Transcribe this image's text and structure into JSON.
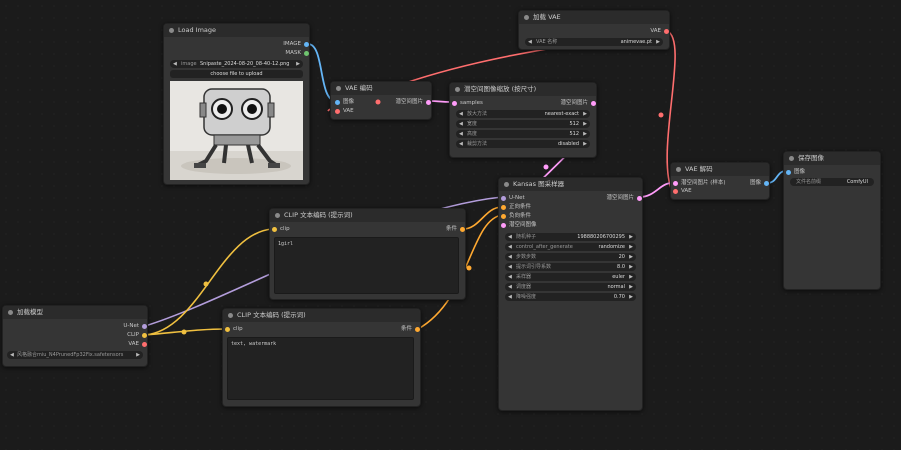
{
  "colors": {
    "clip": "#f0c040",
    "model": "#b39ddb",
    "vae": "#ff6e6e",
    "latent": "#ff9cf9",
    "image": "#64b5f6",
    "conditioning": "#ffa931"
  },
  "load_image": {
    "title": "Load Image",
    "out_image": "IMAGE",
    "out_mask": "MASK",
    "image_label": "image",
    "image_value": "Snipaste_2024-08-20_08-40-12.png",
    "upload_button": "choose file to upload"
  },
  "vae_loader": {
    "title": "加载 VAE",
    "out_vae": "VAE",
    "name_label": "VAE 名称",
    "name_value": "animevae.pt"
  },
  "vae_encode": {
    "title": "VAE 编码",
    "in_pixels": "图像",
    "in_vae": "VAE",
    "out_latent": "潜空间图片"
  },
  "latent_upscale": {
    "title": "潜空间图像缩放 (按尺寸)",
    "in_samples": "samples",
    "out_latent": "潜空间图片",
    "widgets": [
      {
        "label": "放大方法",
        "value": "nearest-exact"
      },
      {
        "label": "宽度",
        "value": "512"
      },
      {
        "label": "高度",
        "value": "512"
      },
      {
        "label": "裁剪方法",
        "value": "disabled"
      }
    ]
  },
  "vae_decode": {
    "title": "VAE 解码",
    "in_samples": "潜空间图片 (样本)",
    "in_vae": "VAE",
    "out_image": "图像"
  },
  "save_image": {
    "title": "保存图像",
    "in_images": "图像",
    "prefix_label": "文件名前缀",
    "prefix_value": "ComfyUI"
  },
  "ksampler": {
    "title": "Kansas 图采样器",
    "in_model": "U-Net",
    "in_positive": "正向条件",
    "in_negative": "负向条件",
    "in_latent": "潜空间图像",
    "out_latent": "潜空间图片",
    "widgets": [
      {
        "label": "随机种子",
        "value": "198880206700295"
      },
      {
        "label": "control_after_generate",
        "value": "randomize"
      },
      {
        "label": "步数步数",
        "value": "20"
      },
      {
        "label": "提示词引导系数",
        "value": "8.0"
      },
      {
        "label": "采样器",
        "value": "euler"
      },
      {
        "label": "调度器",
        "value": "normal"
      },
      {
        "label": "降噪强度",
        "value": "0.70"
      }
    ]
  },
  "clip_text_pos": {
    "title": "CLIP 文本编码 (提示词)",
    "in_clip": "clip",
    "out_cond": "条件",
    "text": "1girl"
  },
  "clip_text_neg": {
    "title": "CLIP 文本编码 (提示词)",
    "in_clip": "clip",
    "out_cond": "条件",
    "text": "text, watermark"
  },
  "checkpoint": {
    "title": "加载模型",
    "out_model": "U-Net",
    "out_clip": "CLIP",
    "out_vae": "VAE",
    "ckpt_value": "风格融合miu_N4PrunedFp32Fix.safetensors"
  }
}
